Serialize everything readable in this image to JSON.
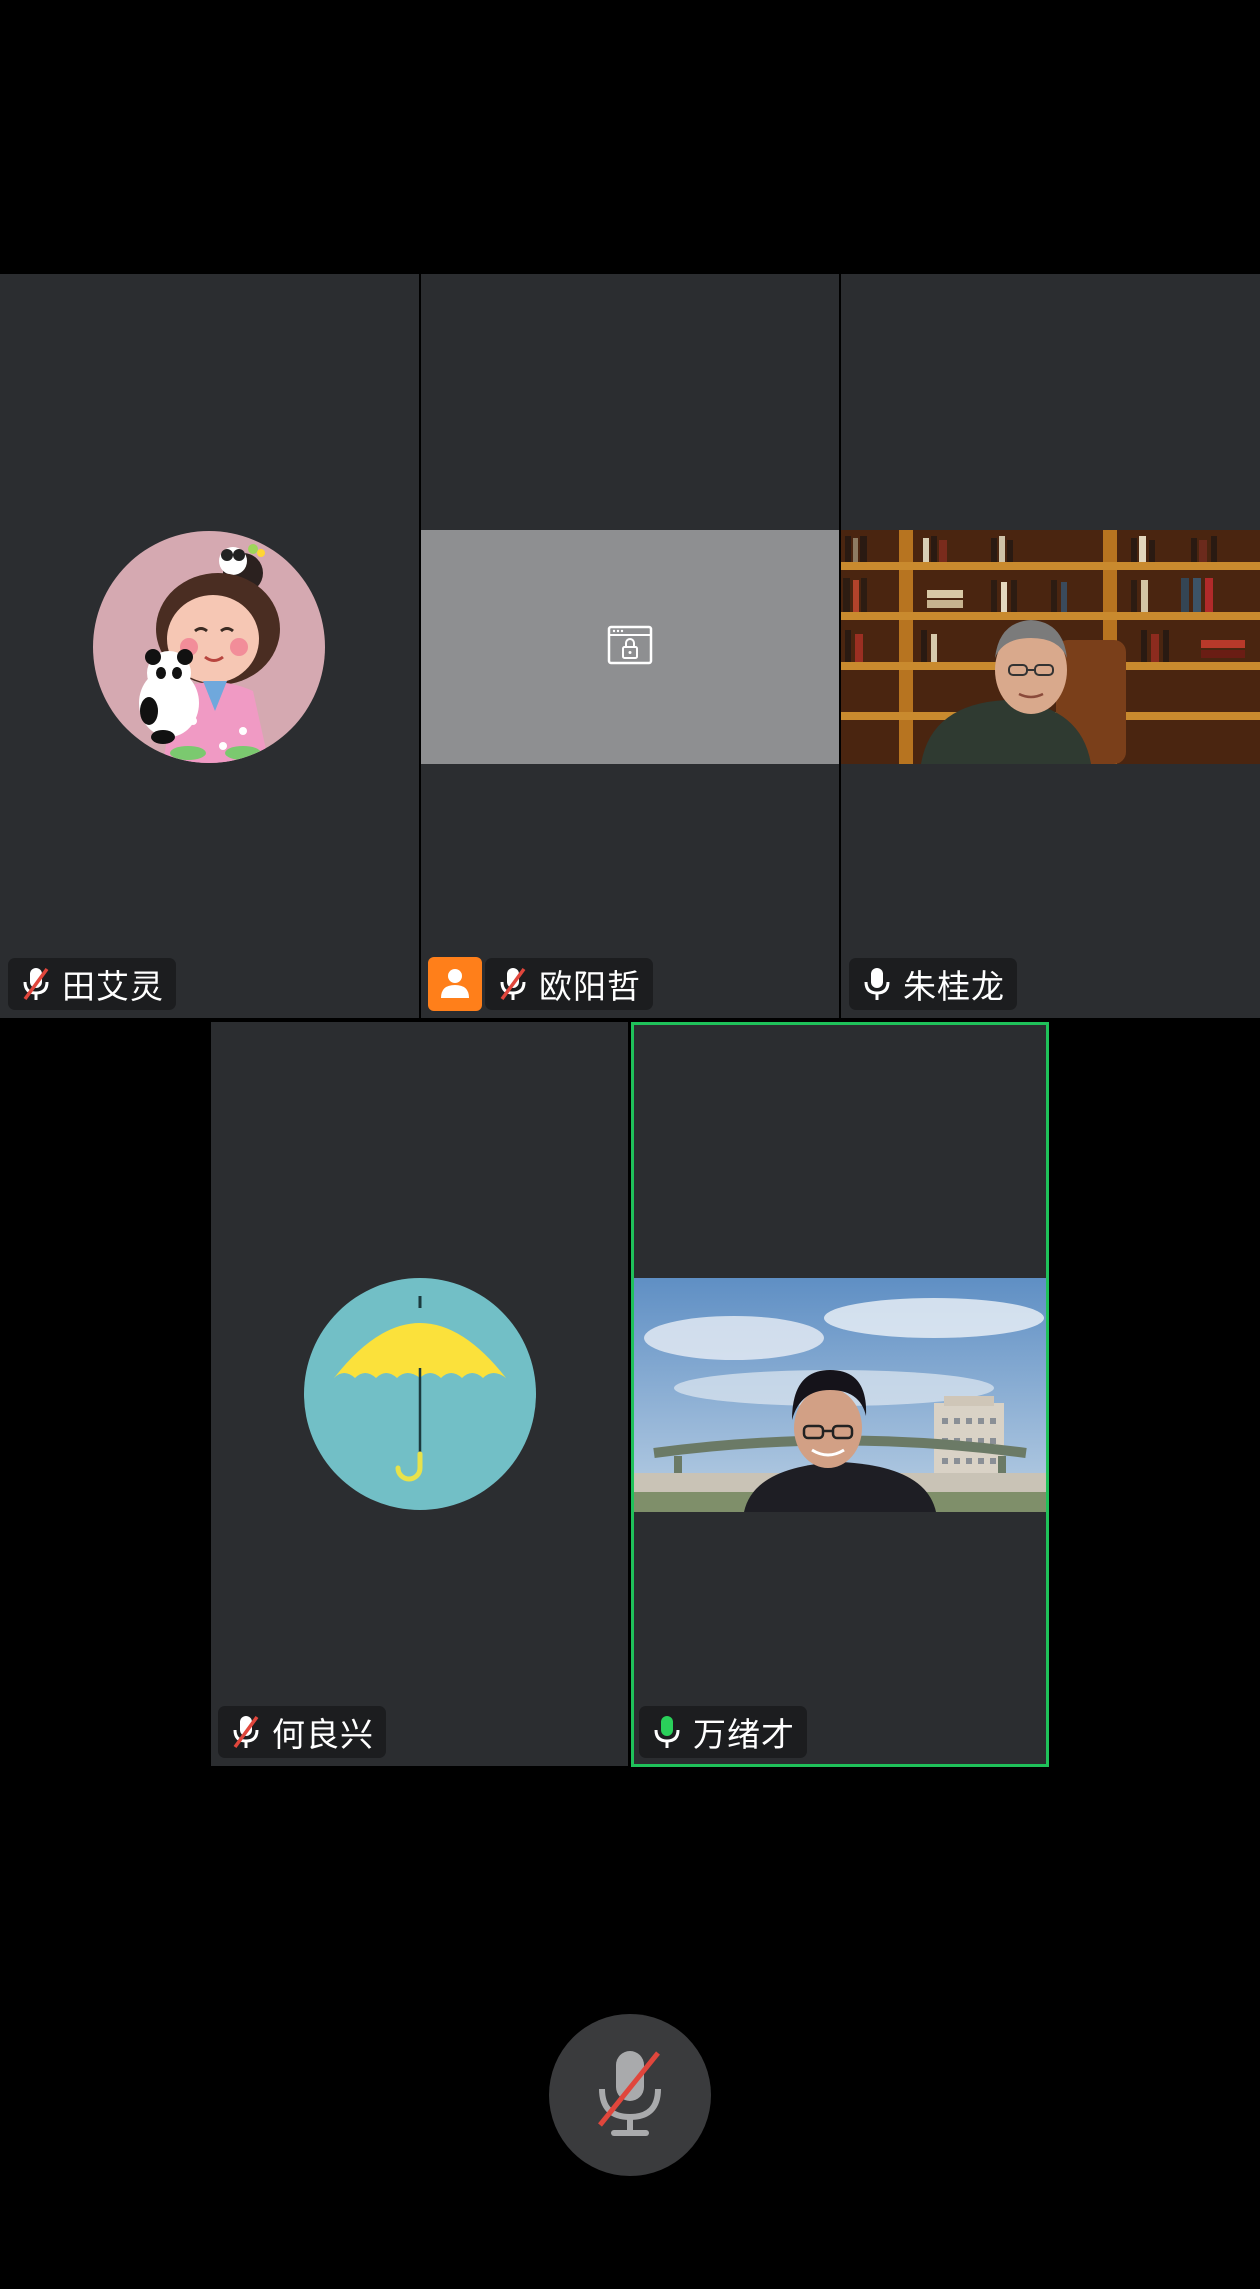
{
  "participants": [
    {
      "name": "田艾灵",
      "mic": "muted",
      "media": "avatar-cartoon-girl-panda"
    },
    {
      "name": "欧阳哲",
      "mic": "muted",
      "media": "locked-screen",
      "host": true
    },
    {
      "name": "朱桂龙",
      "mic": "on",
      "media": "video-bookshelf"
    },
    {
      "name": "何良兴",
      "mic": "muted",
      "media": "avatar-umbrella"
    },
    {
      "name": "万绪才",
      "mic": "speaking",
      "media": "video-campus",
      "active_speaker": true
    }
  ],
  "toolbar": {
    "mic_state": "muted",
    "icon": "mic-muted-icon"
  },
  "colors": {
    "tile_bg": "#2b2d30",
    "active_border": "#1fc15a",
    "host_badge": "#ff7f1a",
    "muted_slash": "#e0463c"
  }
}
